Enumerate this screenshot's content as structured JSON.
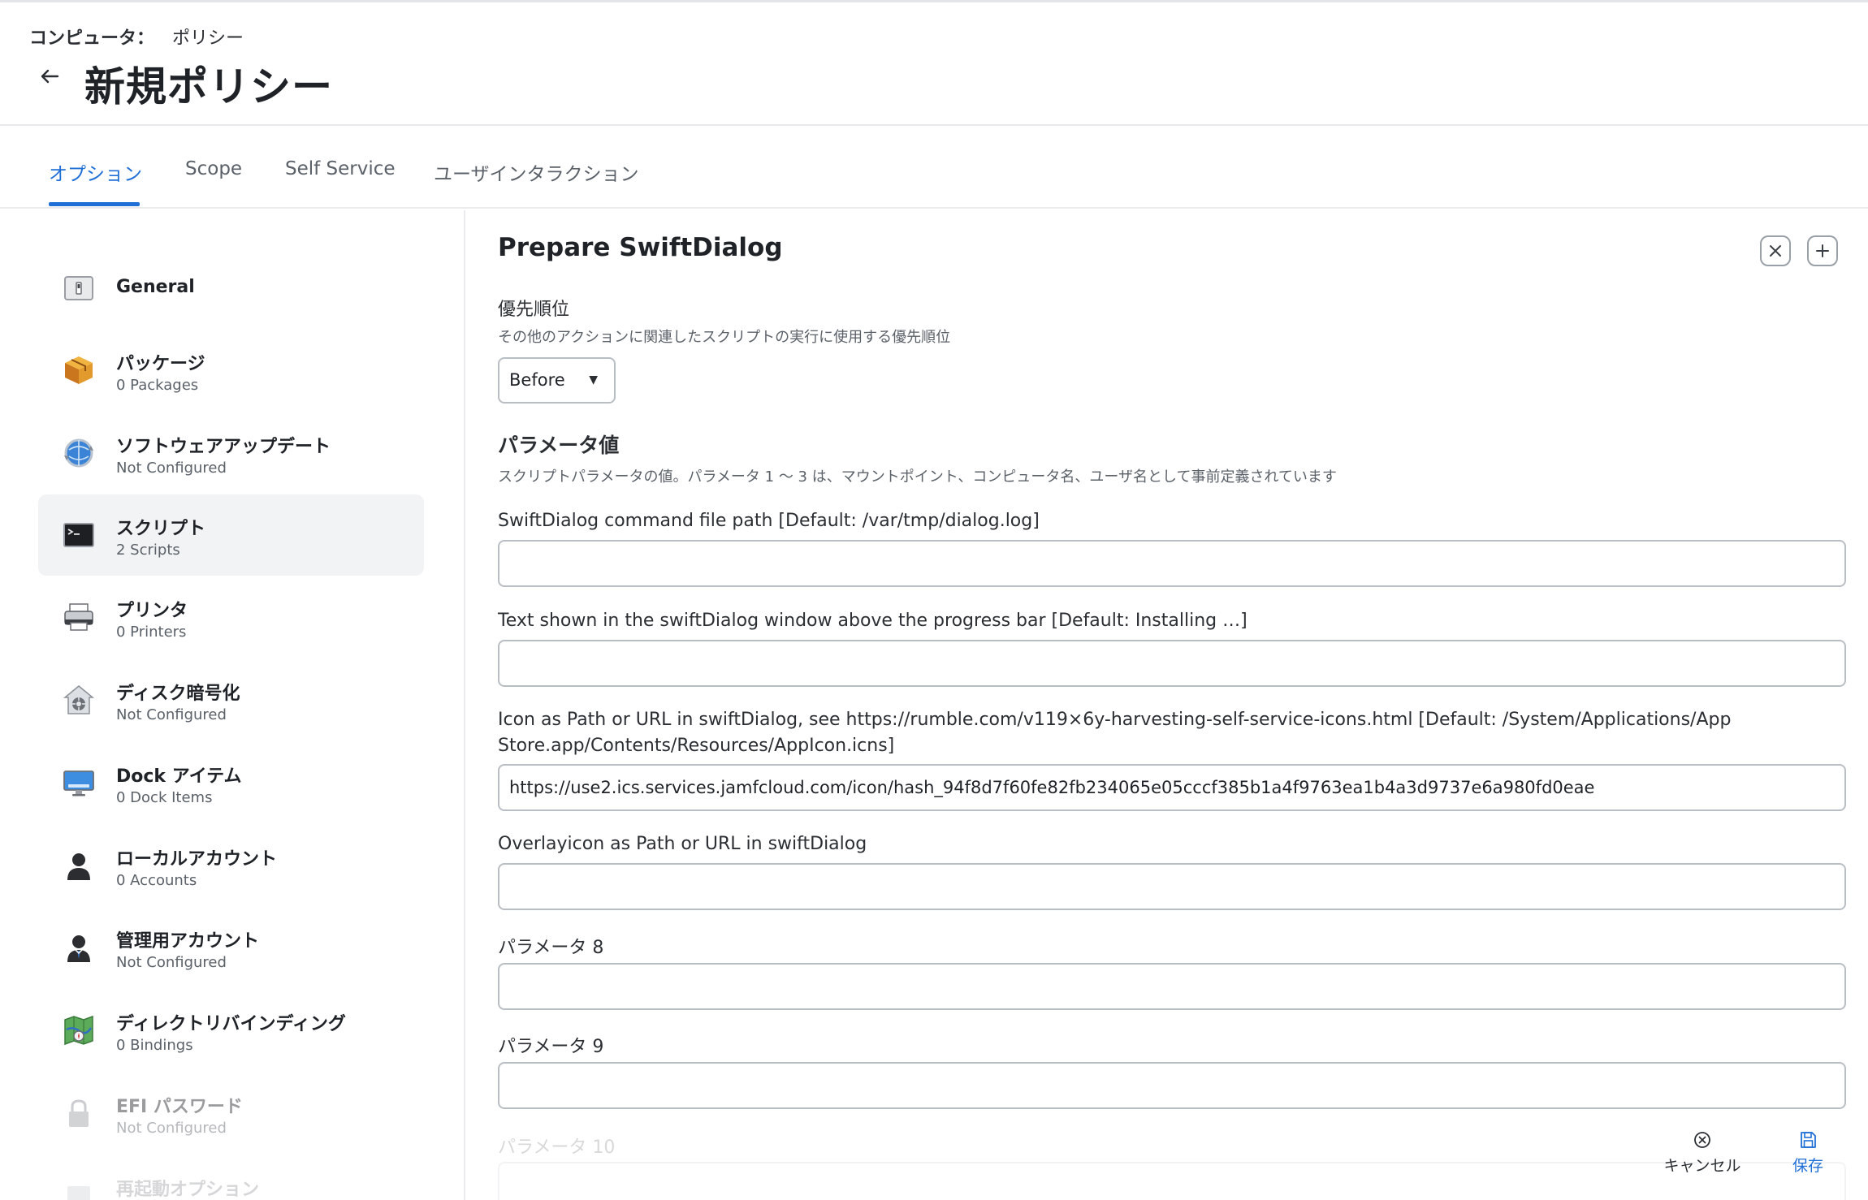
{
  "header": {
    "breadcrumb_root": "コンピュータ：",
    "breadcrumb_current": "ポリシー",
    "title": "新規ポリシー"
  },
  "tabs": [
    {
      "label": "オプション",
      "active": true
    },
    {
      "label": "Scope"
    },
    {
      "label": "Self Service"
    },
    {
      "label": "ユーザインタラクション"
    }
  ],
  "sidebar": {
    "items": [
      {
        "label": "General",
        "sub": ""
      },
      {
        "label": "パッケージ",
        "sub": "0 Packages"
      },
      {
        "label": "ソフトウェアアップデート",
        "sub": "Not Configured"
      },
      {
        "label": "スクリプト",
        "sub": "2 Scripts",
        "selected": true
      },
      {
        "label": "プリンタ",
        "sub": "0 Printers"
      },
      {
        "label": "ディスク暗号化",
        "sub": "Not Configured"
      },
      {
        "label": "Dock アイテム",
        "sub": "0 Dock Items"
      },
      {
        "label": "ローカルアカウント",
        "sub": "0 Accounts"
      },
      {
        "label": "管理用アカウント",
        "sub": "Not Configured"
      },
      {
        "label": "ディレクトリバインディング",
        "sub": "0 Bindings"
      },
      {
        "label": "EFI パスワード",
        "sub": "Not Configured"
      },
      {
        "label": "再起動オプション",
        "sub": ""
      }
    ]
  },
  "main": {
    "section_title": "Prepare SwiftDialog",
    "priority": {
      "label": "優先順位",
      "help": "その他のアクションに関連したスクリプトの実行に使用する優先順位",
      "value": "Before"
    },
    "params": {
      "heading": "パラメータ値",
      "help": "スクリプトパラメータの値。パラメータ 1 〜 3 は、マウントポイント、コンピュータ名、ユーザ名として事前定義されています"
    },
    "fields": [
      {
        "label": "SwiftDialog command file path [Default: /var/tmp/dialog.log]",
        "value": ""
      },
      {
        "label": "Text shown in the swiftDialog window above the progress bar [Default: Installing …]",
        "value": ""
      },
      {
        "label": "Icon as Path or URL in swiftDialog, see https://rumble.com/v119×6y-harvesting-self-service-icons.html [Default: /System/Applications/App Store.app/Contents/Resources/AppIcon.icns]",
        "value": "https://use2.ics.services.jamfcloud.com/icon/hash_94f8d7f60fe82fb234065e05cccf385b1a4f9763ea1b4a3d9737e6a980fd0eae"
      },
      {
        "label": "Overlayicon as Path or URL in swiftDialog",
        "value": ""
      },
      {
        "label": "パラメータ 8",
        "value": ""
      },
      {
        "label": "パラメータ 9",
        "value": ""
      },
      {
        "label": "パラメータ 10",
        "value": ""
      }
    ]
  },
  "footer": {
    "cancel_label": "キャンセル",
    "save_label": "保存"
  },
  "colors": {
    "accent": "#1f6fd6",
    "selected_bg": "#f2f3f5",
    "border": "#b9bec4"
  }
}
